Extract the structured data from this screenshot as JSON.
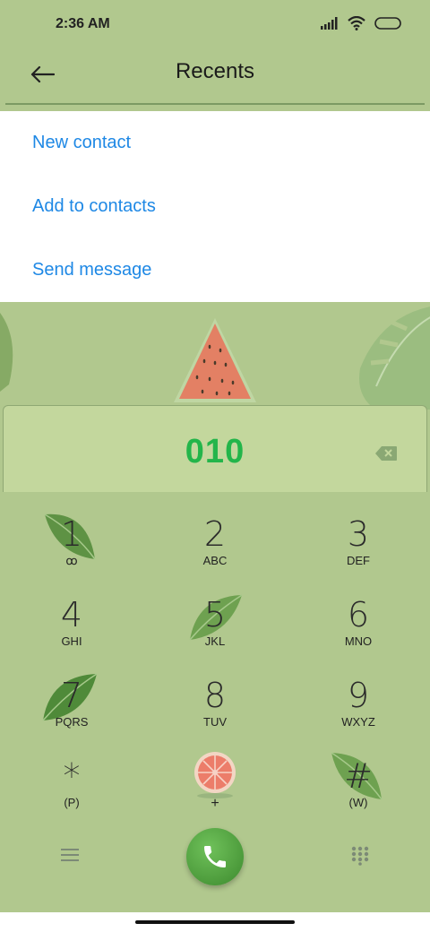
{
  "status_bar": {
    "time": "2:36 AM",
    "icons": [
      "signal-icon",
      "wifi-icon",
      "battery-icon"
    ]
  },
  "header": {
    "title": "Recents",
    "back_icon": "back-arrow-icon"
  },
  "menu": {
    "items": [
      {
        "label": "New contact"
      },
      {
        "label": "Add to contacts"
      },
      {
        "label": "Send message"
      }
    ]
  },
  "dialer": {
    "number": "010",
    "backspace_icon": "backspace-icon"
  },
  "keypad": {
    "keys": [
      {
        "digit": "1",
        "letters": "ꝏ"
      },
      {
        "digit": "2",
        "letters": "ABC"
      },
      {
        "digit": "3",
        "letters": "DEF"
      },
      {
        "digit": "4",
        "letters": "GHI"
      },
      {
        "digit": "5",
        "letters": "JKL"
      },
      {
        "digit": "6",
        "letters": "MNO"
      },
      {
        "digit": "7",
        "letters": "PQRS"
      },
      {
        "digit": "8",
        "letters": "TUV"
      },
      {
        "digit": "9",
        "letters": "WXYZ"
      },
      {
        "digit": "*",
        "letters": "(P)"
      },
      {
        "digit": "0",
        "letters": "+"
      },
      {
        "digit": "#",
        "letters": "(W)"
      }
    ]
  },
  "bottom_bar": {
    "menu_icon": "menu-icon",
    "call_icon": "phone-icon",
    "dialpad_icon": "dialpad-icon"
  },
  "colors": {
    "background": "#b1c88e",
    "accent_blue": "#1e88e5",
    "number_green": "#23b54a",
    "call_green": "#4caf50"
  }
}
